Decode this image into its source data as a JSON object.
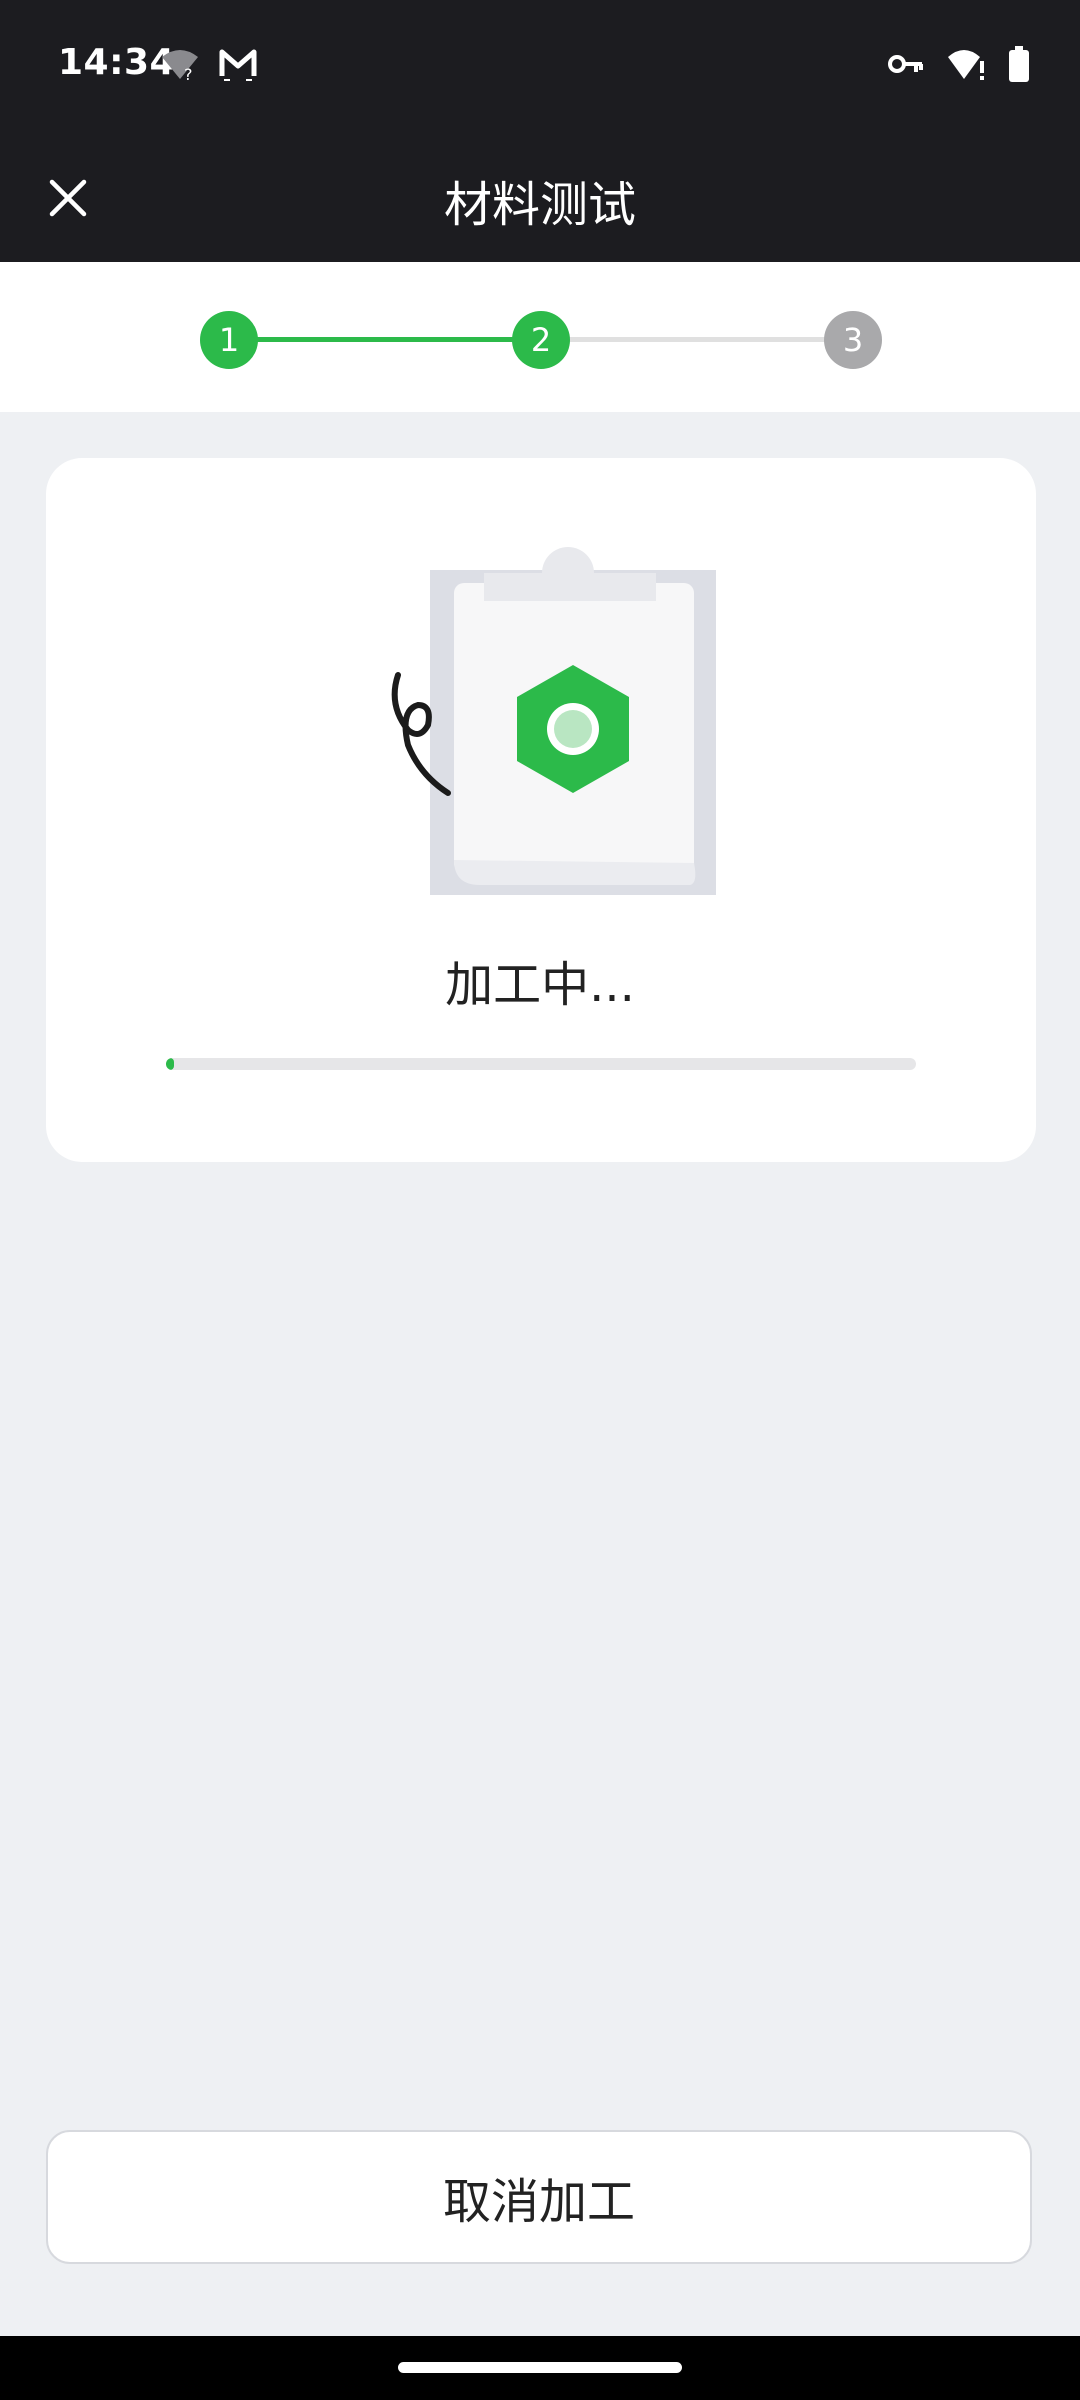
{
  "status_bar": {
    "time": "14:34",
    "left_icons": [
      "wifi-question-icon",
      "mail-icon"
    ],
    "right_icons": [
      "vpn-key-icon",
      "wifi-alert-icon",
      "battery-icon"
    ]
  },
  "app_bar": {
    "title": "材料测试",
    "close_icon": "close-icon"
  },
  "stepper": {
    "current_step": 2,
    "steps": [
      {
        "label": "1",
        "state": "done"
      },
      {
        "label": "2",
        "state": "active"
      },
      {
        "label": "3",
        "state": "pending"
      }
    ],
    "colors": {
      "active": "#2cba4a",
      "pending": "#a9a9ab",
      "line_pending": "#e0e0e0"
    }
  },
  "processing_card": {
    "status_text": "加工中...",
    "progress": 0.01,
    "illustration": "clipboard-hex-nut-illustration"
  },
  "actions": {
    "cancel_label": "取消加工"
  }
}
